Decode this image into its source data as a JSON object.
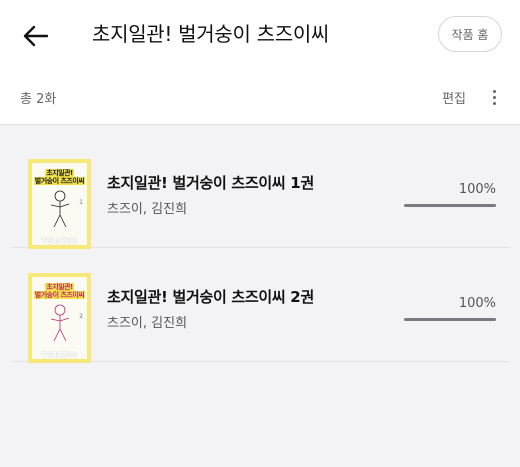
{
  "header": {
    "title": "초지일관! 벌거숭이 츠즈이씨",
    "home_label": "작품 홈"
  },
  "subbar": {
    "total": "총 2화",
    "edit_label": "편집"
  },
  "books": [
    {
      "title": "초지일관! 벌거숭이 츠즈이씨 1권",
      "author": "츠즈이, 김진희",
      "progress_text": "100%",
      "progress": 1.0,
      "cover_line1": "초지일관!",
      "cover_line2": "벌거숭이 츠즈이씨",
      "cover_volume": "1",
      "cover_footer": "TSUZUI",
      "cover_line_color": "#222222"
    },
    {
      "title": "초지일관! 벌거숭이 츠즈이씨 2권",
      "author": "츠즈이, 김진희",
      "progress_text": "100%",
      "progress": 1.0,
      "cover_line1": "초지일관!",
      "cover_line2": "벌거숭이 츠즈이씨",
      "cover_volume": "2",
      "cover_footer": "TSUZUI",
      "cover_line_color": "#c02a6a"
    }
  ],
  "colors": {
    "background": "#f3f3f5",
    "cover_yellow": "#f6e97a",
    "progress_fill": "#7a7a80"
  },
  "icons": {
    "back": "arrow-left-icon",
    "more": "more-vertical-icon"
  }
}
